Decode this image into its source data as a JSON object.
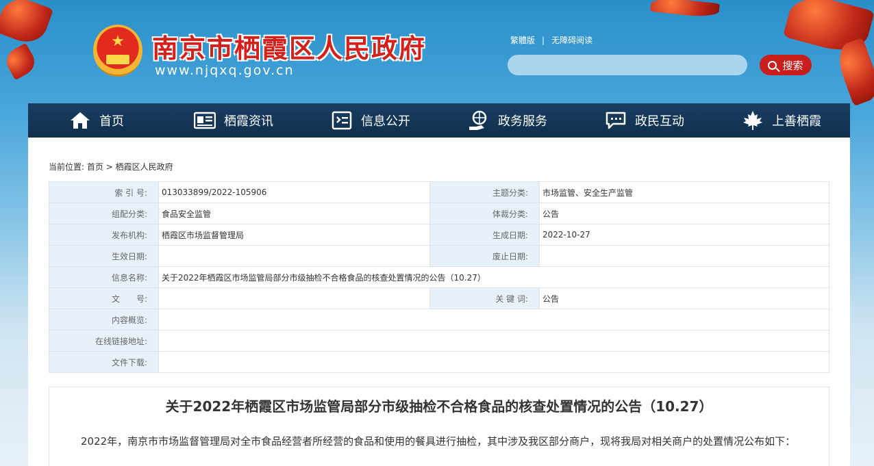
{
  "header": {
    "site_title": "南京市栖霞区人民政府",
    "site_url": "www.njqxq.gov.cn",
    "lang_link": "繁體版",
    "accessibility_link": "无障碍阅读",
    "search_placeholder": "",
    "search_button": "搜索"
  },
  "nav": {
    "items": [
      {
        "label": "首页",
        "icon": "home-icon"
      },
      {
        "label": "栖霞资讯",
        "icon": "news-icon"
      },
      {
        "label": "信息公开",
        "icon": "info-open-icon"
      },
      {
        "label": "政务服务",
        "icon": "government-service-icon"
      },
      {
        "label": "政民互动",
        "icon": "chat-icon"
      },
      {
        "label": "上善栖霞",
        "icon": "maple-leaf-icon"
      }
    ]
  },
  "breadcrumb": {
    "prefix": "当前位置:",
    "home": "首页",
    "separator": ">",
    "current": "栖霞区人民政府"
  },
  "meta": {
    "index_label": "索 引 号:",
    "index_value": "013033899/2022-105906",
    "topic_label": "主题分类:",
    "topic_value": "市场监管、安全生产监管",
    "org_category_label": "组配分类:",
    "org_category_value": "食品安全监管",
    "genre_label": "体裁分类:",
    "genre_value": "公告",
    "publisher_label": "发布机构:",
    "publisher_value": "栖霞区市场监督管理局",
    "created_label": "生成日期:",
    "created_value": "2022-10-27",
    "effective_label": "生效日期:",
    "effective_value": "",
    "repeal_label": "废止日期:",
    "repeal_value": "",
    "info_name_label": "信息名称:",
    "info_name_value": "关于2022年栖霞区市场监管局部分市级抽检不合格食品的核查处置情况的公告（10.27）",
    "doc_no_label": "文　　号:",
    "doc_no_value": "",
    "keywords_label": "关 键 词:",
    "keywords_value": "公告",
    "summary_label": "内容概览:",
    "summary_value": "",
    "online_link_label": "在线链接地址:",
    "online_link_value": "",
    "download_label": "文件下载:",
    "download_value": ""
  },
  "article": {
    "title": "关于2022年栖霞区市场监管局部分市级抽检不合格食品的核查处置情况的公告（10.27）",
    "paragraph": "2022年，南京市市场监督管理局对全市食品经营者所经营的食品和使用的餐具进行抽检，其中涉及我区部分商户，现将我局对相关商户的处置情况公布如下："
  },
  "colors": {
    "brand_red": "#d4201a",
    "nav_bg": "#0f2e4c",
    "meta_key_bg": "#e8f1fa"
  }
}
